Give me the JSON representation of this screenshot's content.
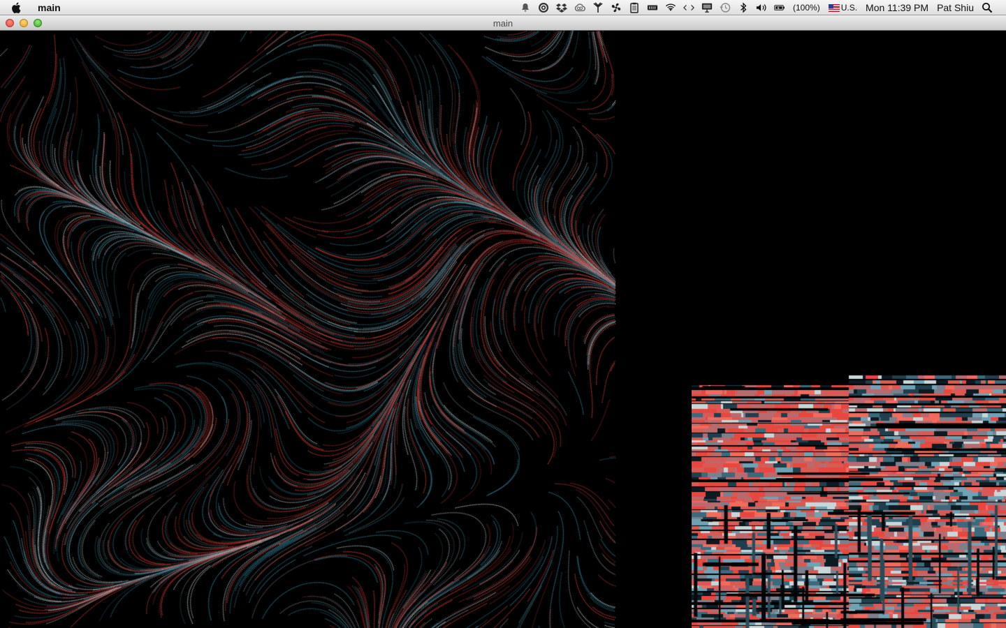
{
  "menubar": {
    "app_name": "main",
    "battery_text": "(100%)",
    "input_source": "U.S.",
    "clock": "Mon 11:39 PM",
    "user_name": "Pat Shiu",
    "status_icons": [
      "notification-center-icon",
      "sync-icon",
      "dropbox-icon",
      "creative-cloud-icon",
      "antenna-icon",
      "fan-icon",
      "clipboard-icon",
      "memory-icon",
      "wifi-icon",
      "code-icon",
      "display-icon",
      "time-machine-icon",
      "bluetooth-icon",
      "volume-icon",
      "battery-icon",
      "flag-icon",
      "spotlight-icon"
    ]
  },
  "window": {
    "title": "main"
  },
  "colors": {
    "particle_red": "#e8473f",
    "particle_blue": "#3a8fa8",
    "particle_pale": "#c9d6d8",
    "background": "#000000"
  }
}
